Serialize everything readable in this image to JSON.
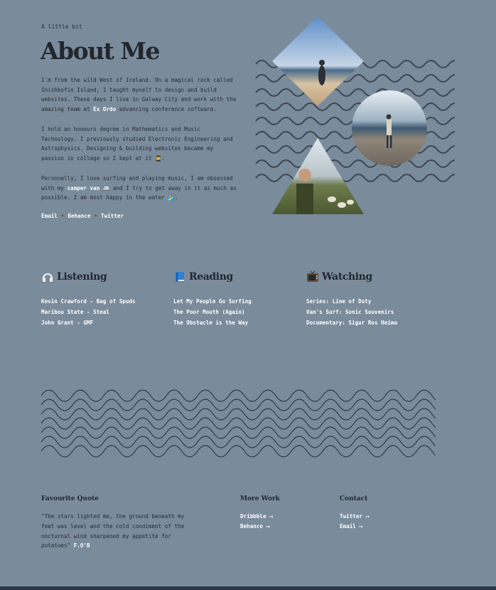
{
  "intro": {
    "kicker": "A little bit",
    "title": "About Me"
  },
  "bio": {
    "p1_a": "I'm from the wild West of Ireland. On a magical rock called Inishbofin Island, I taught myself to design and build websites. These days I live in Galway City and work with the amazing team at ",
    "p1_link": "Ex Ordo",
    "p1_b": " advancing conference software.",
    "p2": "I hold an honours degree in Mathematics and Music Technology. I previously studied Electronic Engineering and Astrophysics. Designing & building websites became my passion in college so I kept at it 👨‍🎓.",
    "p3_a": "Personally, I love surfing and playing music, I am obsessed with my ",
    "p3_link": "camper van",
    "p3_emoji": " 🚐",
    "p3_b": " and I try to get away in it as much as possible. I am most happy in the water 🏄."
  },
  "social": {
    "email": "Email",
    "behance": "Behance",
    "twitter": "Twitter",
    "separator": "•"
  },
  "columns": {
    "listening": {
      "icon": "headphones-icon",
      "title": "Listening",
      "items": [
        "Kevin Crawford - Bag of Spuds",
        "Maribou State - Steal",
        "John Grant - GMF"
      ]
    },
    "reading": {
      "icon": "book-icon",
      "title": "Reading",
      "items": [
        "Let My People Go Surfing",
        "The Poor Mouth (Again)",
        "The Obstacle is the Way"
      ]
    },
    "watching": {
      "icon": "television-icon",
      "title": "Watching",
      "items": [
        "Series: Line of Duty",
        "Van's Surf: Sonic Souvenirs",
        "Documentary: Sigur Ros Heima"
      ]
    }
  },
  "footer": {
    "quote_head": "Favourite Quote",
    "quote_text": "\"The stars lighted me, the ground beneath my feet was level and the cold condiment of the nocturnal wind sharpened my appetite for potatoes\" ",
    "quote_author": "F.O'B",
    "work_head": "More Work",
    "work_links": [
      "Dribbble ⟶",
      "Behance ⟶"
    ],
    "contact_head": "Contact",
    "contact_links": [
      "Twitter ⟶",
      "Email ⟶"
    ]
  },
  "colors": {
    "background": "#7a8b9c",
    "text": "#262b31",
    "link": "#ffffff",
    "wave_stroke": "#3c4650",
    "bottom_bar": "#2a3547"
  }
}
